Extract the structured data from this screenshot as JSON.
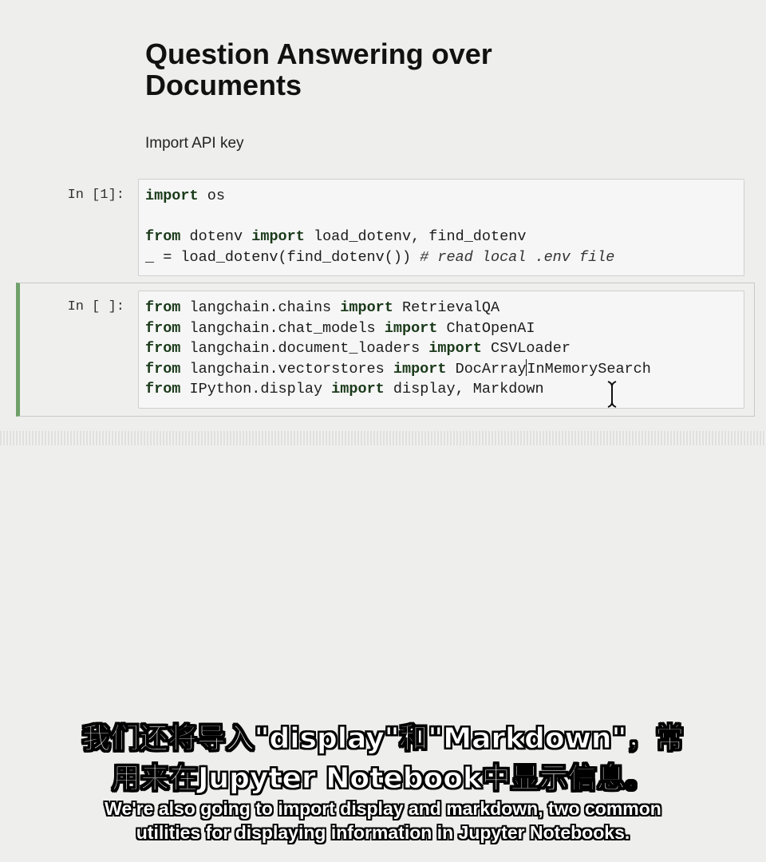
{
  "notebook": {
    "heading_line1": "Question Answering over",
    "heading_line2": "Documents",
    "md_text": "Import API key",
    "cell1": {
      "prompt": "In [1]:",
      "lines": [
        {
          "kw1": "import",
          "rest": " os"
        },
        {
          "blank": true
        },
        {
          "kw1": "from",
          "mid": " dotenv ",
          "kw2": "import",
          "rest": " load_dotenv, find_dotenv"
        },
        {
          "pre": "_ = load_dotenv(find_dotenv()) ",
          "comment": "# read local .env file"
        }
      ]
    },
    "cell2": {
      "prompt": "In [ ]:",
      "lines": [
        {
          "kw1": "from",
          "mid": " langchain.chains ",
          "kw2": "import",
          "rest": " RetrievalQA"
        },
        {
          "kw1": "from",
          "mid": " langchain.chat_models ",
          "kw2": "import",
          "rest": " ChatOpenAI"
        },
        {
          "kw1": "from",
          "mid": " langchain.document_loaders ",
          "kw2": "import",
          "rest": " CSVLoader"
        },
        {
          "kw1": "from",
          "mid": " langchain.vectorstores ",
          "kw2": "import",
          "rest_a": " DocArray",
          "rest_b": "InMemorySearch"
        },
        {
          "kw1": "from",
          "mid": " IPython.display ",
          "kw2": "import",
          "rest": " display, Markdown"
        }
      ]
    }
  },
  "subtitles": {
    "cn_line1": "我们还将导入\"display\"和\"Markdown\"，常",
    "cn_line2": "用来在Jupyter Notebook中显示信息。",
    "en_line1": "We're also going to import display and markdown, two common",
    "en_line2": "utilities for displaying information in Jupyter Notebooks."
  }
}
